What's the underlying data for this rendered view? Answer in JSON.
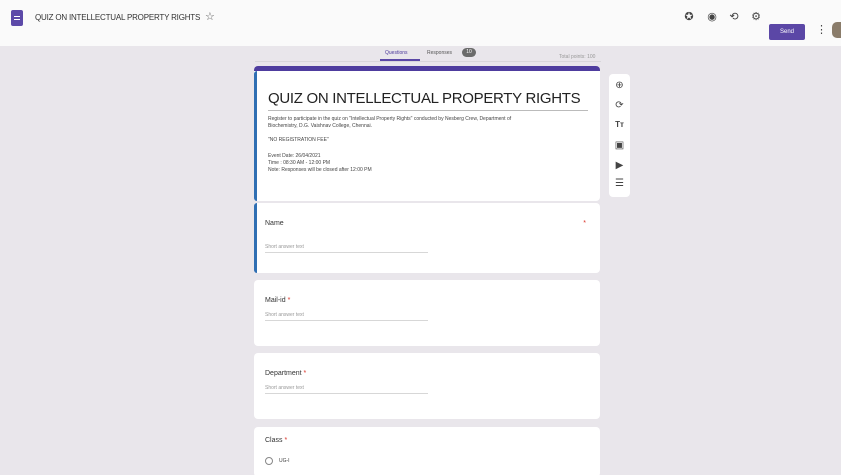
{
  "app": {
    "title": "QUIZ ON INTELLECTUAL PROPERTY RIGHTS",
    "send_label": "Send"
  },
  "icons": {
    "doc": "forms-doc-icon",
    "star": "☆",
    "palette": "✪",
    "preview": "◉",
    "undo": "⟲",
    "settings": "⚙",
    "more": "⋮"
  },
  "tabs": {
    "questions": "Questions",
    "responses": "Responses",
    "responses_count": "10",
    "total_points": "Total points: 100"
  },
  "form": {
    "title": "QUIZ ON INTELLECTUAL PROPERTY RIGHTS",
    "desc_line1": "Register to participate in the quiz on \"Intellectual Property Rights\" conducted by Nesberg Crew, Department of",
    "desc_line2": "Biochemistry, D.G. Vaishnav College, Chennai.",
    "desc_fee": "\"NO REGISTRATION FEE\"",
    "event_date": "Event Date: 26/04/2021",
    "time": "Time : 08:30 AM - 12:00 PM",
    "note": "Note: Responses will be closed after 12:00 PM"
  },
  "questions": [
    {
      "label": "Name",
      "placeholder": "Short answer text",
      "required_mark": "*"
    },
    {
      "label": "Mail-id",
      "placeholder": "Short answer text",
      "required_mark": "*"
    },
    {
      "label": "Department",
      "placeholder": "Short answer text",
      "required_mark": "*"
    },
    {
      "label": "Class",
      "required_mark": "*",
      "option": "UG-I"
    }
  ],
  "toolbar_side": [
    "⊕",
    "⟳",
    "Tт",
    "▣",
    "▶",
    "☰"
  ],
  "colors": {
    "accent": "#5b47a6",
    "header_border": "#4e3c9e",
    "active_left": "#2f6fb3",
    "background": "#e9e6eb"
  }
}
